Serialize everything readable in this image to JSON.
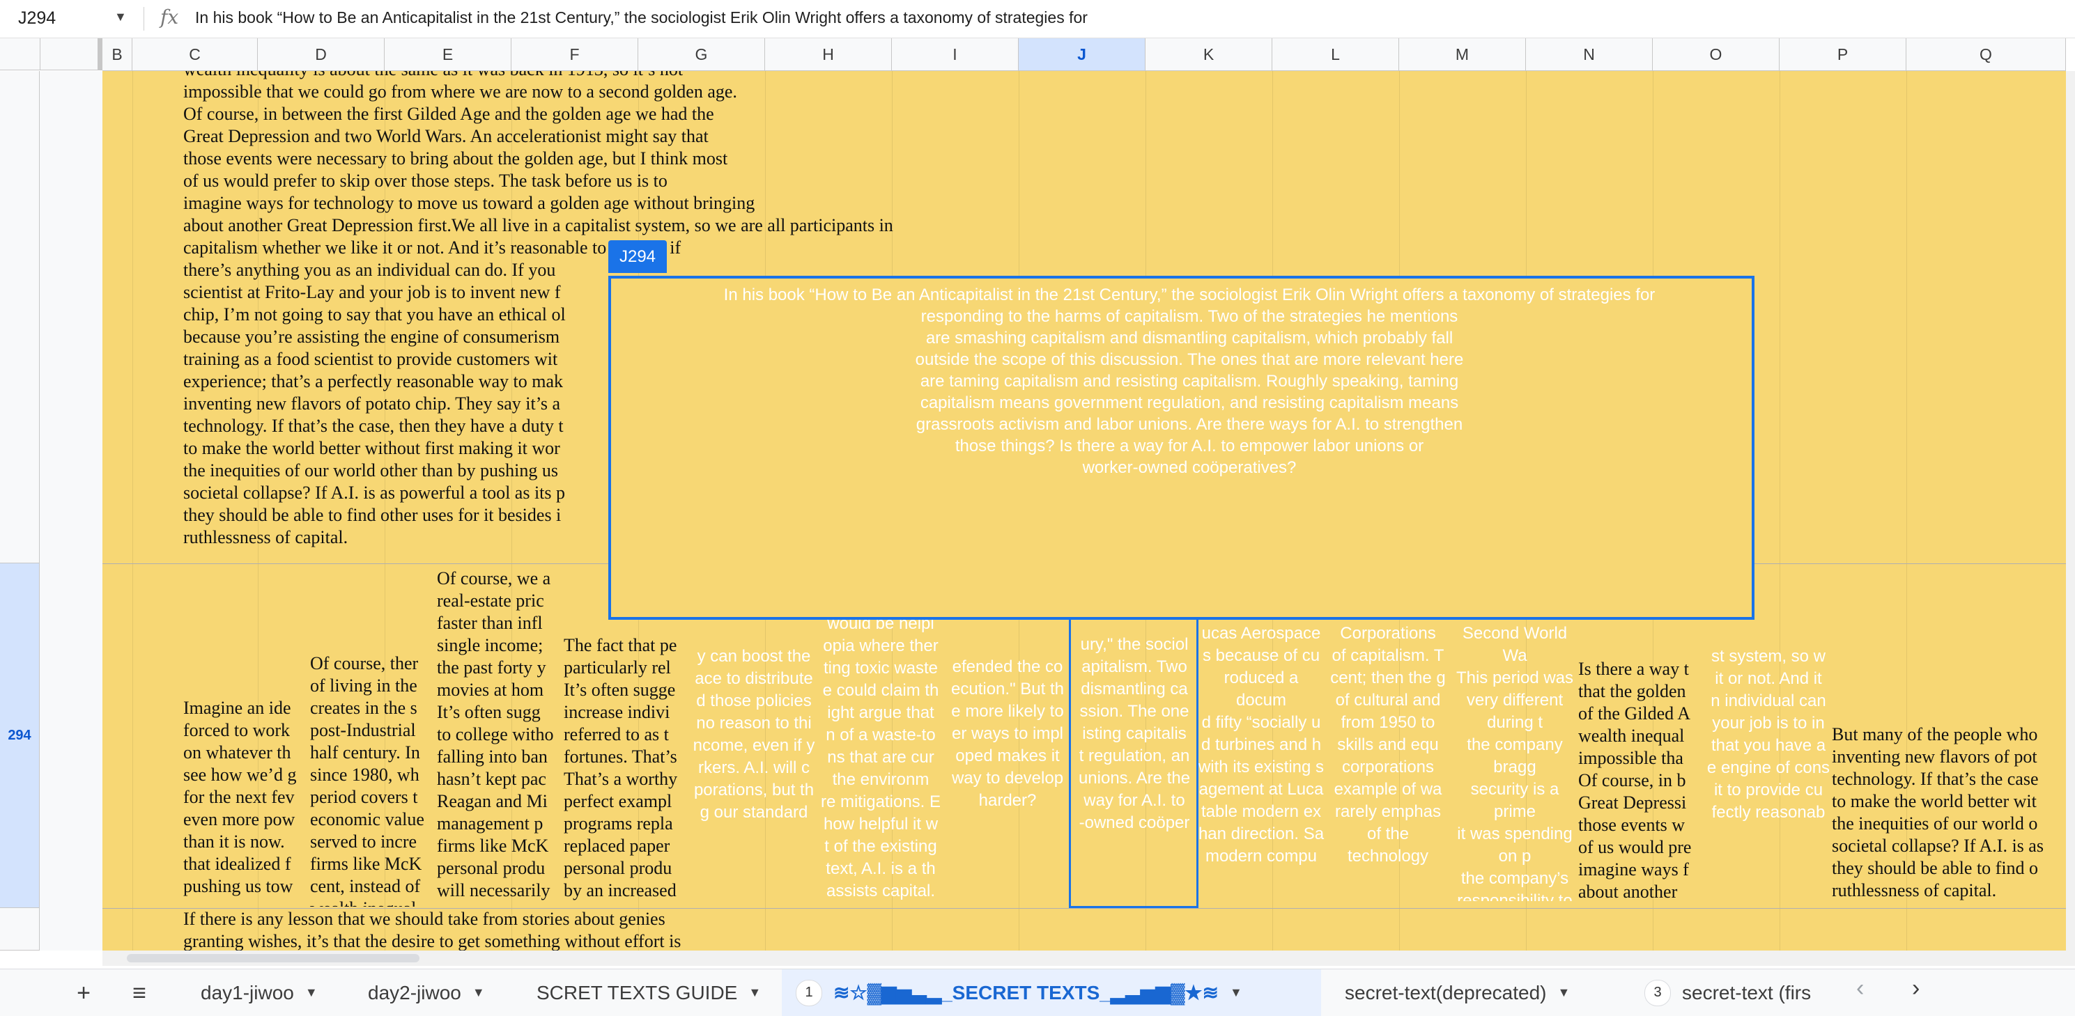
{
  "formula_bar": {
    "cell_ref": "J294",
    "fx": "fx",
    "content": "In his book “How to Be an Anticapitalist in the 21st Century,” the sociologist Erik Olin Wright offers a taxonomy of strategies for"
  },
  "columns": [
    "B",
    "C",
    "D",
    "E",
    "F",
    "G",
    "H",
    "I",
    "J",
    "K",
    "L",
    "M",
    "N",
    "O",
    "P",
    "Q"
  ],
  "selected_column": "J",
  "rows": {
    "selected": "294"
  },
  "cells": {
    "top_c": "wealth inequality is about the same as it was back in 1913, so it’s not\nimpossible that we could go from where we are now to a second golden age.\nOf course, in between the first Gilded Age and the golden age we had the\nGreat Depression and two World Wars. An accelerationist might say that\nthose events were necessary to bring about the golden age, but I think most\nof us would prefer to skip over those steps. The task before us is to\nimagine ways for technology to move us toward a golden age without bringing\nabout another Great Depression first.We all live in a capitalist system, so we are all participants in\ncapitalism whether we like it or not. And it’s reasonable to wonder if\nthere’s anything you as an individual can do. If you\nscientist at Frito-Lay and your job is to invent new f\nchip, I’m not going to say that you have an ethical ol\nbecause you’re assisting the engine of consumerism\ntraining as a food scientist to provide customers wit\nexperience; that’s a perfectly reasonable way to mak\ninventing new flavors of potato chip. They say it’s a\ntechnology. If that’s the case, then they have a duty t\nto make the world better without first making it wor\nthe inequities of our world other than by pushing us\nsocietal collapse? If A.I. is as powerful a tool as its p\nthey should be able to find other uses for it besides i\nruthlessness of capital.",
    "r294_c": "Imagine an ide\nforced to work\non whatever th\nsee how we’d g\nfor the next fev\neven more pow\nthan it is now.\nthat idealized f\npushing us tow",
    "r294_d": "Of course, ther\nof living in the\ncreates in the s\npost-Industrial\nhalf century. In\nsince 1980, wh\nperiod covers t\neconomic value\nserved to incre\nfirms like McK\ncent, instead of\nwealth inequal\nwhole.",
    "r294_e": "Of course, we a\nreal-estate pric\nfaster than infl\nsingle income;\nthe past forty y\nmovies at hom\nIt’s often sugg\nto college witho\nfalling into ban\nhasn’t kept pac\nReagan and Mi\nmanagement p\nfirms like McK\npersonal produ\nwill necessarily",
    "r294_f": "The fact that pe\nparticularly rel\nIt’s often sugge\nincrease indivi\nreferred to as t\nfortunes. That’s\nThat’s a worthy\nperfect exampl\nprograms repla\nreplaced paper\npersonal produ\nby an increased",
    "r294_g": "y can boost the\nace to distribute\nd those policies\nno reason to thi\nncome, even if y\nrkers. A.I. will c\nporations, but th\ng our standard",
    "r294_h": "would be helpi\nopia where ther\nting toxic waste\ne could claim th\night argue that\nn of a waste-to\nns that are cur\nthe environm\nre mitigations. E\nhow helpful it w\nt of the existing\ntext, A.I. is a th\nassists capital.",
    "r294_i": "efended the co\necution.\" But th\ne more likely to\ner ways to impl\noped makes it\nway to develop\nharder?",
    "r294_j": "ury,\" the sociol\napitalism. Two\ndismantling ca\nssion. The one\nisting capitalis\nt regulation, an\nunions. Are the\nway for A.I. to\n-owned coöper",
    "r294_k": "ucas Aerospace\ns because of cu\nroduced a docum\nd fifty “socially u\nd turbines and h\nwith its existing s\nagement at Luca\ntable modern ex\nhan direction. Sa\nmodern compu",
    "r294_l": "Corporations\nof capitalism. T\ncent; then the g\nof cultural and\nfrom 1950 to\nskills and equ\ncorporations\nexample of wa\nrarely emphas\nof the technology",
    "r294_m": "Second World Wa\nThis period was\nvery different during t\nthe company bragg\nsecurity is a prime\nit was spending on p\nthe company’s\nresponsibility to its shar\nconception of their\ncorporations toda",
    "r294_n": "Is there a way t\nthat the golden\nof the Gilded A\nwealth inequal\nimpossible tha\nOf course, in b\nGreat Depressi\nthose events w\nof us would pre\nimagine ways f\nabout another",
    "r294_o": "st system, so w\nit or not. And it\nn individual can\nyour job is to in\nthat you have a\ne engine of cons\nit to provide cu\nfectly reasonab",
    "r294_p": "But many of the people who\ninventing new flavors of pot\ntechnology. If that’s the case\nto make the world better wit\nthe inequities of our world o\nsocietal collapse? If A.I. is as\nthey should be able to find o\nruthlessness of capital.",
    "bottom_c": "If there is any lesson that we should take from stories about genies\ngranting wishes, it’s that the desire to get something without effort is"
  },
  "popup": {
    "tag": "J294",
    "text": "In his book “How to Be an Anticapitalist in the 21st Century,” the sociologist Erik Olin Wright offers a taxonomy of strategies for\nresponding to the harms of capitalism. Two of the strategies he mentions\nare smashing capitalism and dismantling capitalism, which probably fall\noutside the scope of this discussion. The ones that are more relevant here\nare taming capitalism and resisting capitalism. Roughly speaking, taming\ncapitalism means government regulation, and resisting capitalism means\ngrassroots activism and labor unions. Are there ways for A.I. to strengthen\nthose things? Is there a way for A.I. to empower labor unions or\nworker-owned coöperatives?"
  },
  "tabs": {
    "add": "+",
    "all_sheets": "≡",
    "items": [
      {
        "label": "day1-jiwoo"
      },
      {
        "label": "day2-jiwoo"
      },
      {
        "label": "SCRET TEXTS GUIDE"
      },
      {
        "label": "≋☆▓▆▅▃▂_SECRET TEXTS_▂▃▅▆▓★≋",
        "badge": "1"
      },
      {
        "label": "secret-text(deprecated)"
      },
      {
        "label": "secret-text (firs",
        "badge": "3"
      }
    ],
    "prev": "‹",
    "next": "›"
  },
  "colors": {
    "cell_fill": "#f7d774",
    "selection": "#1a73e8",
    "header_selected": "#d3e3fd"
  }
}
